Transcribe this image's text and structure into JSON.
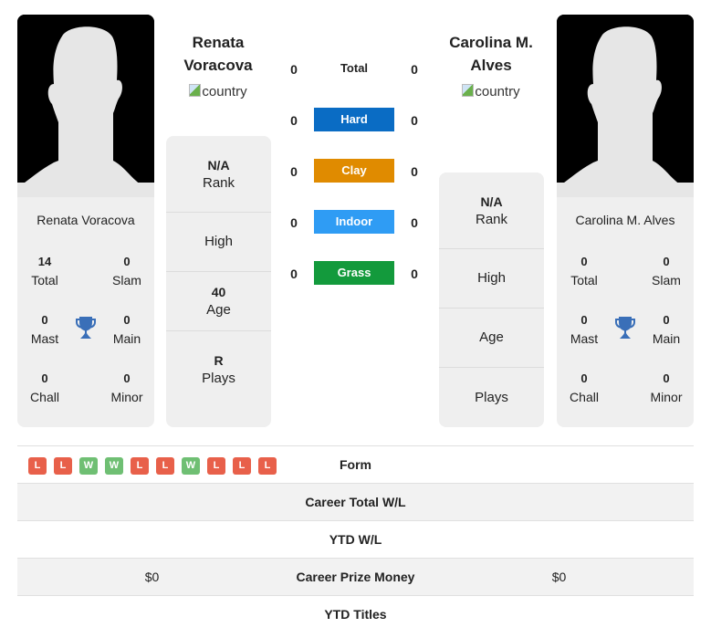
{
  "players": {
    "left": {
      "name": "Renata Voracova",
      "name_line1": "Renata",
      "name_line2": "Voracova",
      "country_alt": "country",
      "titles": {
        "total": "14",
        "slam": "0",
        "mast": "0",
        "main": "0",
        "chall": "0",
        "minor": "0"
      },
      "rank": "N/A",
      "high": "",
      "age": "40",
      "plays": "R"
    },
    "right": {
      "name": "Carolina M. Alves",
      "name_line1": "Carolina M.",
      "name_line2": "Alves",
      "country_alt": "country",
      "titles": {
        "total": "0",
        "slam": "0",
        "mast": "0",
        "main": "0",
        "chall": "0",
        "minor": "0"
      },
      "rank": "N/A",
      "high": "",
      "age": "",
      "plays": ""
    }
  },
  "labels": {
    "total": "Total",
    "slam": "Slam",
    "mast": "Mast",
    "main": "Main",
    "chall": "Chall",
    "minor": "Minor",
    "rank": "Rank",
    "high": "High",
    "age": "Age",
    "plays": "Plays"
  },
  "surfaces": [
    {
      "label": "Total",
      "left": "0",
      "right": "0",
      "color": ""
    },
    {
      "label": "Hard",
      "left": "0",
      "right": "0",
      "color": "#0a6cc4"
    },
    {
      "label": "Clay",
      "left": "0",
      "right": "0",
      "color": "#e08b00"
    },
    {
      "label": "Indoor",
      "left": "0",
      "right": "0",
      "color": "#2f9cf4"
    },
    {
      "label": "Grass",
      "left": "0",
      "right": "0",
      "color": "#139a3c"
    }
  ],
  "table": {
    "form_label": "Form",
    "left_form": [
      "L",
      "L",
      "W",
      "W",
      "L",
      "L",
      "W",
      "L",
      "L",
      "L"
    ],
    "rows": [
      {
        "label": "Career Total W/L",
        "left": "",
        "right": ""
      },
      {
        "label": "YTD W/L",
        "left": "",
        "right": ""
      },
      {
        "label": "Career Prize Money",
        "left": "$0",
        "right": "$0"
      },
      {
        "label": "YTD Titles",
        "left": "",
        "right": ""
      }
    ]
  },
  "colors": {
    "trophy": "#3a6fb8",
    "form_loss": "#e8604a",
    "form_win": "#6fbf73"
  }
}
